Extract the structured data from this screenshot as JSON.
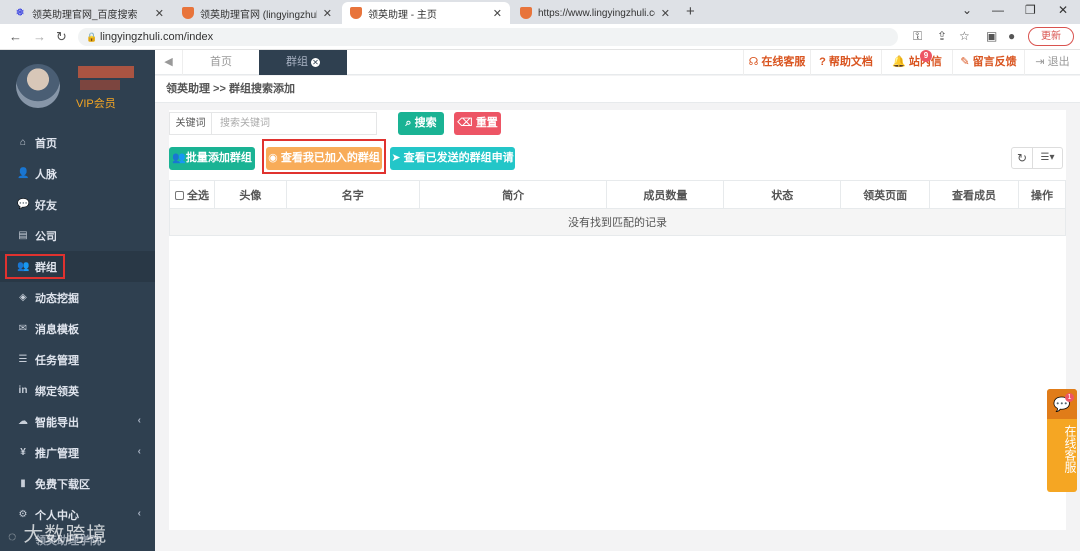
{
  "browser": {
    "tabs": [
      {
        "title": "领英助理官网_百度搜索",
        "active": false
      },
      {
        "title": "领英助理官网 (lingyingzhuli.com)",
        "active": false
      },
      {
        "title": "领英助理 - 主页",
        "active": true
      },
      {
        "title": "https://www.lingyingzhuli.com",
        "active": false
      }
    ],
    "url": "lingyingzhuli.com/index",
    "update_label": "更新"
  },
  "sidebar": {
    "vip_label": "VIP会员",
    "items": [
      {
        "label": "首页",
        "icon": "home-icon"
      },
      {
        "label": "人脉",
        "icon": "add-user-icon"
      },
      {
        "label": "好友",
        "icon": "chat-icon"
      },
      {
        "label": "公司",
        "icon": "building-icon"
      },
      {
        "label": "群组",
        "icon": "group-icon"
      },
      {
        "label": "动态挖掘",
        "icon": "cube-icon"
      },
      {
        "label": "消息模板",
        "icon": "envelope-icon"
      },
      {
        "label": "任务管理",
        "icon": "list-icon"
      },
      {
        "label": "绑定领英",
        "icon": "linkedin-icon"
      },
      {
        "label": "智能导出",
        "icon": "cloud-download-icon"
      },
      {
        "label": "推广管理",
        "icon": "yen-icon"
      },
      {
        "label": "免费下载区",
        "icon": "file-icon"
      },
      {
        "label": "个人中心",
        "icon": "gear-icon"
      },
      {
        "label": "领英助理学院",
        "icon": "book-icon"
      }
    ],
    "watermark": "大数跨境"
  },
  "topnav": {
    "home_tab": "首页",
    "group_tab": "群组",
    "online_service": "在线客服",
    "help_docs": "帮助文档",
    "site_messages": "站内信",
    "message_badge": "9",
    "feedback": "留言反馈",
    "logout": "退出"
  },
  "breadcrumb": "领英助理 >> 群组搜索添加",
  "search": {
    "keyword_label": "关键词",
    "keyword_placeholder": "搜索关键词",
    "search_button": "搜索",
    "reset_button": "重置"
  },
  "actions": {
    "batch_add": "批量添加群组",
    "view_joined": "查看我已加入的群组",
    "view_sent": "查看已发送的群组申请"
  },
  "table": {
    "select_all": "全选",
    "columns": [
      "头像",
      "名字",
      "简介",
      "成员数量",
      "状态",
      "领英页面",
      "查看成员",
      "操作"
    ],
    "empty_message": "没有找到匹配的记录"
  },
  "float_service": {
    "label": "在线客服",
    "badge": "1"
  },
  "colors": {
    "sidebar_bg": "#2f4050",
    "primary_green": "#1ab394",
    "danger_red": "#ed5565",
    "warning_orange": "#f8ac59",
    "info_cyan": "#23c6c8",
    "accent_orange": "#d9541f"
  }
}
